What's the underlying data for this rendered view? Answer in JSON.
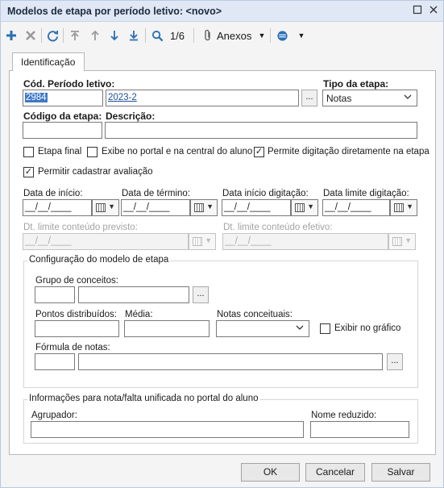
{
  "window": {
    "title": "Modelos de etapa por período letivo: <novo>"
  },
  "toolbar": {
    "record_counter": "1/6",
    "attachments_label": "Anexos"
  },
  "tab": {
    "label": "Identificação"
  },
  "form": {
    "periodo_label": "Cód. Período letivo:",
    "periodo_code": "2984",
    "periodo_desc": "2023-2",
    "tipo_label": "Tipo da etapa:",
    "tipo_value": "Notas",
    "codigo_label": "Código da etapa:",
    "descricao_label": "Descrição:",
    "ellipsis": "...",
    "checks": {
      "etapa_final": "Etapa final",
      "exibe_portal": "Exibe no portal e na central do aluno",
      "permite_digitacao": "Permite digitação diretamente na etapa",
      "permitir_avaliacao": "Permitir cadastrar avaliação",
      "checked_mark": "✓"
    },
    "dates": {
      "inicio_label": "Data de início:",
      "termino_label": "Data de término:",
      "inicio_digitacao_label": "Data início digitação:",
      "limite_digitacao_label": "Data limite digitação:",
      "mask": "__/__/____",
      "limite_previsto_label": "Dt. limite conteúdo previsto:",
      "limite_efetivo_label": "Dt. limite conteúdo efetivo:"
    },
    "config": {
      "title": "Configuração do modelo de etapa",
      "grupo_label": "Grupo de conceitos:",
      "pontos_label": "Pontos distribuídos:",
      "media_label": "Média:",
      "notas_conceituais_label": "Notas conceituais:",
      "exibir_grafico_label": "Exibir no gráfico",
      "formula_label": "Fórmula de notas:"
    },
    "portal": {
      "title": "Informações para nota/falta unificada no portal do aluno",
      "agrupador_label": "Agrupador:",
      "nome_reduzido_label": "Nome reduzido:"
    }
  },
  "buttons": {
    "ok": "OK",
    "cancel": "Cancelar",
    "save": "Salvar"
  },
  "colors": {
    "accent": "#2a6fb6",
    "selection": "#3d79c6"
  }
}
